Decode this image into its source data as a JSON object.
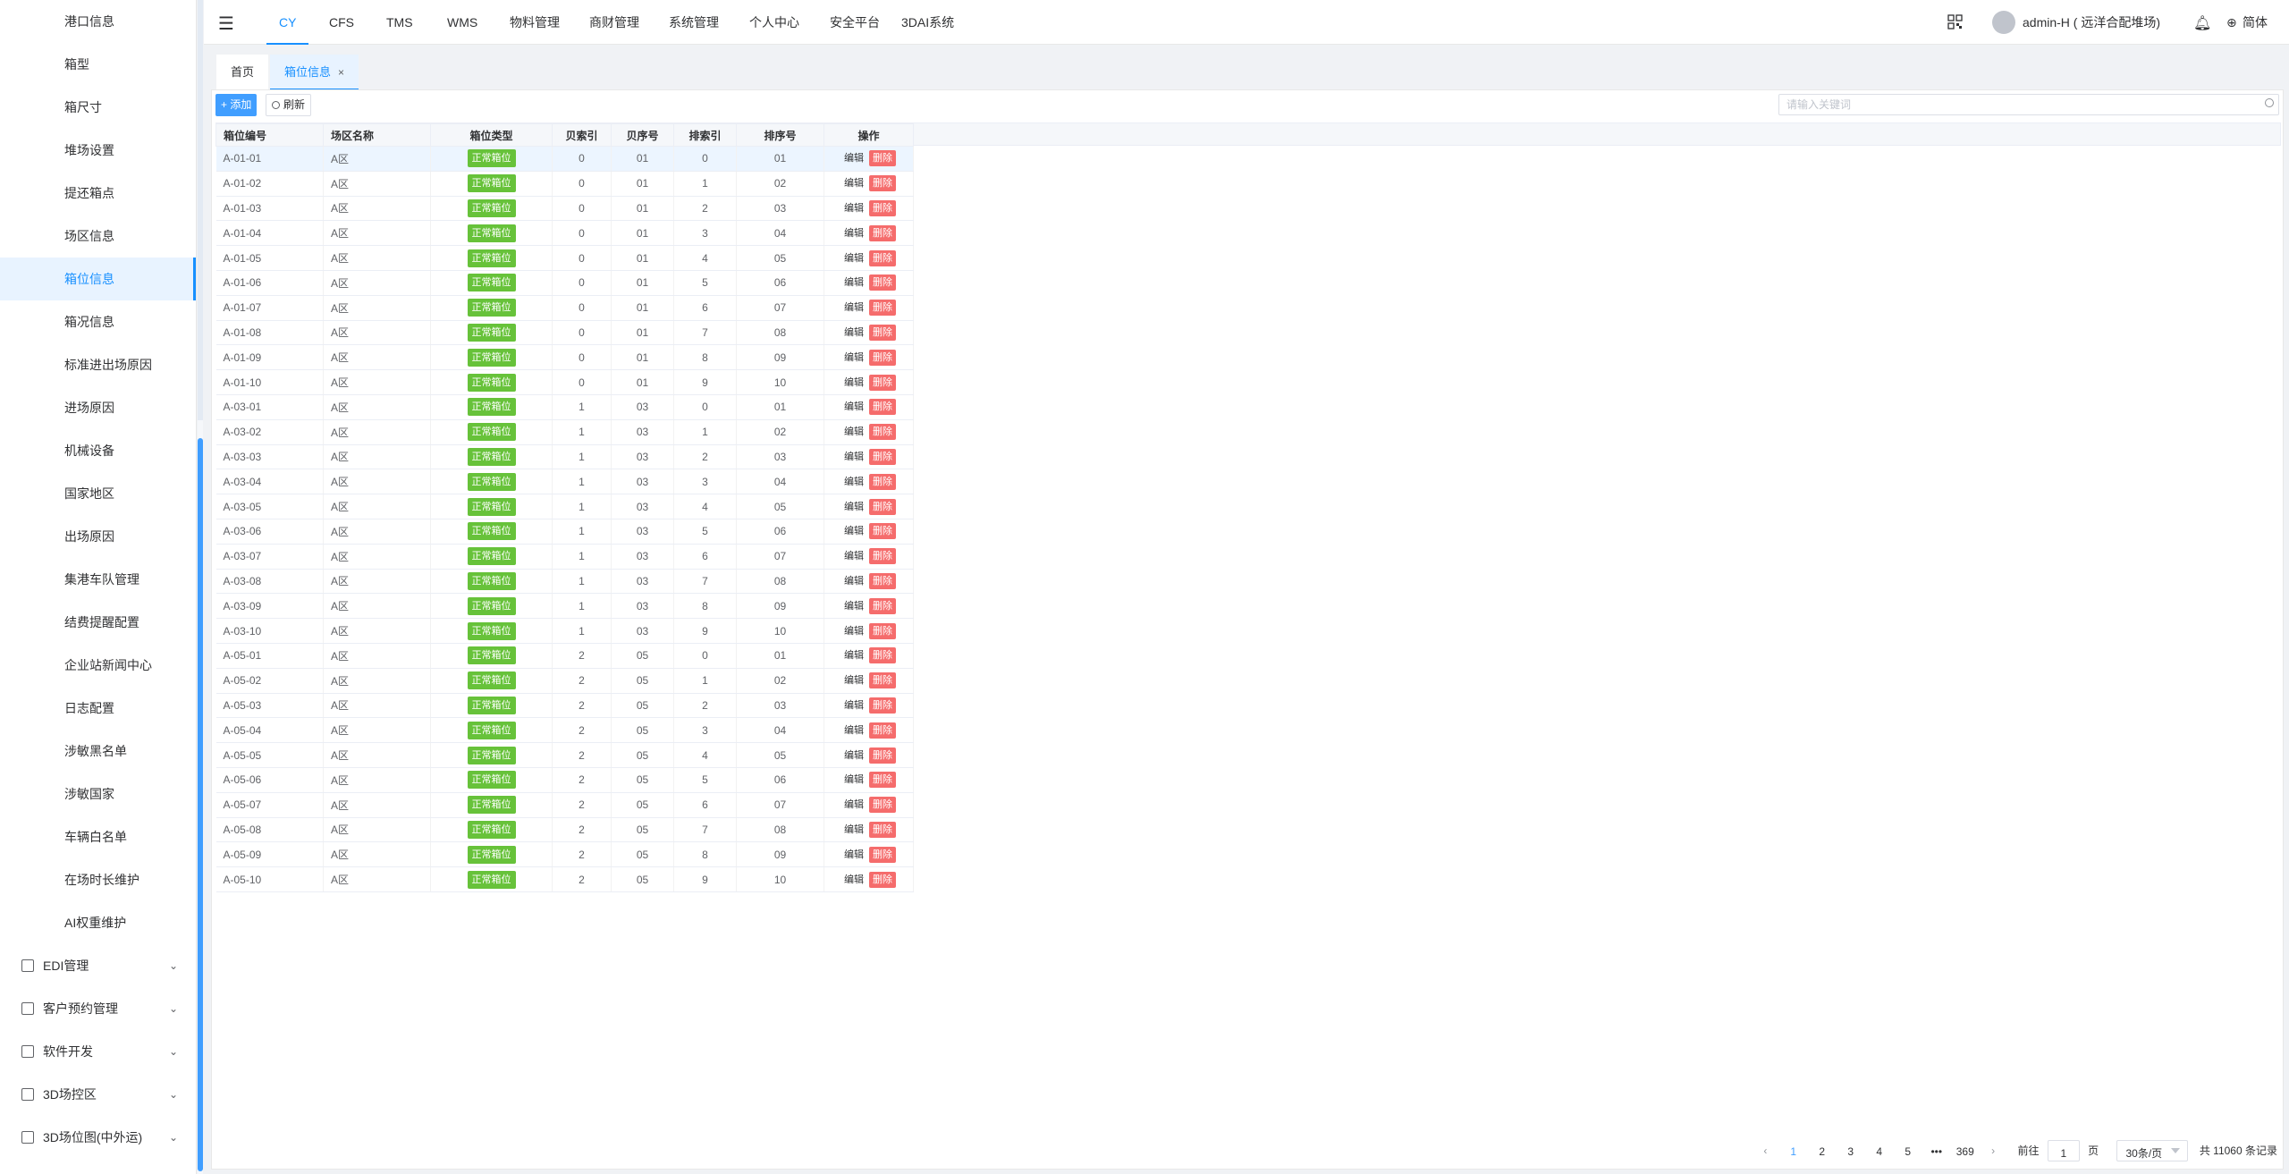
{
  "sidebar": {
    "items": [
      {
        "label": "港口信息"
      },
      {
        "label": "箱型"
      },
      {
        "label": "箱尺寸"
      },
      {
        "label": "堆场设置"
      },
      {
        "label": "提还箱点"
      },
      {
        "label": "场区信息"
      },
      {
        "label": "箱位信息",
        "active": true
      },
      {
        "label": "箱况信息"
      },
      {
        "label": "标准进出场原因"
      },
      {
        "label": "进场原因"
      },
      {
        "label": "机械设备"
      },
      {
        "label": "国家地区"
      },
      {
        "label": "出场原因"
      },
      {
        "label": "集港车队管理"
      },
      {
        "label": "结费提醒配置"
      },
      {
        "label": "企业站新闻中心"
      },
      {
        "label": "日志配置"
      },
      {
        "label": "涉敏黑名单"
      },
      {
        "label": "涉敏国家"
      },
      {
        "label": "车辆白名单"
      },
      {
        "label": "在场时长维护"
      },
      {
        "label": "AI权重维护"
      }
    ],
    "groups": [
      {
        "label": "EDI管理",
        "icon": "edit-icon"
      },
      {
        "label": "客户预约管理",
        "icon": "calendar-icon"
      },
      {
        "label": "软件开发",
        "icon": "monitor-icon"
      },
      {
        "label": "3D场控区",
        "icon": "cube-icon"
      },
      {
        "label": "3D场位图(中外运)",
        "icon": "cube-icon"
      }
    ]
  },
  "header": {
    "nav": [
      "CY",
      "CFS",
      "TMS",
      "WMS",
      "物料管理",
      "商财管理",
      "系统管理",
      "个人中心",
      "安全平台",
      "3DAI系统"
    ],
    "active_nav": "CY",
    "user": "admin-H ( 远洋合配堆场)",
    "language": "简体"
  },
  "tabs": [
    {
      "label": "首页"
    },
    {
      "label": "箱位信息",
      "active": true,
      "close": "×"
    }
  ],
  "toolbar": {
    "add_label": "+ 添加",
    "refresh_label": "刷新",
    "search_placeholder": "请输入关键词"
  },
  "table": {
    "columns": [
      "箱位编号",
      "场区名称",
      "箱位类型",
      "贝索引",
      "贝序号",
      "排索引",
      "排序号",
      "操作"
    ],
    "rows": [
      [
        "A-01-01",
        "A区",
        "正常箱位",
        "0",
        "01",
        "0",
        "01"
      ],
      [
        "A-01-02",
        "A区",
        "正常箱位",
        "0",
        "01",
        "1",
        "02"
      ],
      [
        "A-01-03",
        "A区",
        "正常箱位",
        "0",
        "01",
        "2",
        "03"
      ],
      [
        "A-01-04",
        "A区",
        "正常箱位",
        "0",
        "01",
        "3",
        "04"
      ],
      [
        "A-01-05",
        "A区",
        "正常箱位",
        "0",
        "01",
        "4",
        "05"
      ],
      [
        "A-01-06",
        "A区",
        "正常箱位",
        "0",
        "01",
        "5",
        "06"
      ],
      [
        "A-01-07",
        "A区",
        "正常箱位",
        "0",
        "01",
        "6",
        "07"
      ],
      [
        "A-01-08",
        "A区",
        "正常箱位",
        "0",
        "01",
        "7",
        "08"
      ],
      [
        "A-01-09",
        "A区",
        "正常箱位",
        "0",
        "01",
        "8",
        "09"
      ],
      [
        "A-01-10",
        "A区",
        "正常箱位",
        "0",
        "01",
        "9",
        "10"
      ],
      [
        "A-03-01",
        "A区",
        "正常箱位",
        "1",
        "03",
        "0",
        "01"
      ],
      [
        "A-03-02",
        "A区",
        "正常箱位",
        "1",
        "03",
        "1",
        "02"
      ],
      [
        "A-03-03",
        "A区",
        "正常箱位",
        "1",
        "03",
        "2",
        "03"
      ],
      [
        "A-03-04",
        "A区",
        "正常箱位",
        "1",
        "03",
        "3",
        "04"
      ],
      [
        "A-03-05",
        "A区",
        "正常箱位",
        "1",
        "03",
        "4",
        "05"
      ],
      [
        "A-03-06",
        "A区",
        "正常箱位",
        "1",
        "03",
        "5",
        "06"
      ],
      [
        "A-03-07",
        "A区",
        "正常箱位",
        "1",
        "03",
        "6",
        "07"
      ],
      [
        "A-03-08",
        "A区",
        "正常箱位",
        "1",
        "03",
        "7",
        "08"
      ],
      [
        "A-03-09",
        "A区",
        "正常箱位",
        "1",
        "03",
        "8",
        "09"
      ],
      [
        "A-03-10",
        "A区",
        "正常箱位",
        "1",
        "03",
        "9",
        "10"
      ],
      [
        "A-05-01",
        "A区",
        "正常箱位",
        "2",
        "05",
        "0",
        "01"
      ],
      [
        "A-05-02",
        "A区",
        "正常箱位",
        "2",
        "05",
        "1",
        "02"
      ],
      [
        "A-05-03",
        "A区",
        "正常箱位",
        "2",
        "05",
        "2",
        "03"
      ],
      [
        "A-05-04",
        "A区",
        "正常箱位",
        "2",
        "05",
        "3",
        "04"
      ],
      [
        "A-05-05",
        "A区",
        "正常箱位",
        "2",
        "05",
        "4",
        "05"
      ],
      [
        "A-05-06",
        "A区",
        "正常箱位",
        "2",
        "05",
        "5",
        "06"
      ],
      [
        "A-05-07",
        "A区",
        "正常箱位",
        "2",
        "05",
        "6",
        "07"
      ],
      [
        "A-05-08",
        "A区",
        "正常箱位",
        "2",
        "05",
        "7",
        "08"
      ],
      [
        "A-05-09",
        "A区",
        "正常箱位",
        "2",
        "05",
        "8",
        "09"
      ],
      [
        "A-05-10",
        "A区",
        "正常箱位",
        "2",
        "05",
        "9",
        "10"
      ]
    ],
    "edit_label": "编辑",
    "delete_label": "删除"
  },
  "pagination": {
    "pages": [
      "1",
      "2",
      "3",
      "4",
      "5",
      "•••",
      "369"
    ],
    "current": "1",
    "goto_prefix": "前往",
    "goto_value": "1",
    "goto_suffix": "页",
    "page_size": "30条/页",
    "total": "共 11060 条记录"
  },
  "colors": {
    "accent": "#1890ff",
    "badge_green": "#67c23a",
    "delete_red": "#f56c6c"
  }
}
